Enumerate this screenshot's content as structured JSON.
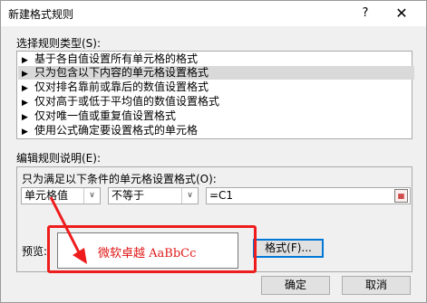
{
  "dialog": {
    "title": "新建格式规则",
    "help_label": "?",
    "close_label": "✕"
  },
  "rule_type": {
    "label": "选择规则类型(S):",
    "items": [
      {
        "label": "基于各自值设置所有单元格的格式"
      },
      {
        "label": "只为包含以下内容的单元格设置格式"
      },
      {
        "label": "仅对排名靠前或靠后的数值设置格式"
      },
      {
        "label": "仅对高于或低于平均值的数值设置格式"
      },
      {
        "label": "仅对唯一值或重复值设置格式"
      },
      {
        "label": "使用公式确定要设置格式的单元格"
      }
    ],
    "selected_index": 1
  },
  "rule_description": {
    "label": "编辑规则说明(E):",
    "condition_label": "只为满足以下条件的单元格设置格式(O):",
    "field_combo": "单元格值",
    "operator_combo": "不等于",
    "value_input": "=C1",
    "preview_label": "预览:",
    "preview_text": "微软卓越  AaBbCc",
    "format_button": "格式(F)..."
  },
  "footer": {
    "ok_label": "确定",
    "cancel_label": "取消"
  },
  "icons": {
    "list_bullet": "▶",
    "dropdown": "∨",
    "ref": "collapse-range-icon"
  },
  "colors": {
    "annotation": "#ee1c1c",
    "preview_text": "#e01818",
    "selection": "#d9d9d9",
    "focus": "#0078d7"
  }
}
